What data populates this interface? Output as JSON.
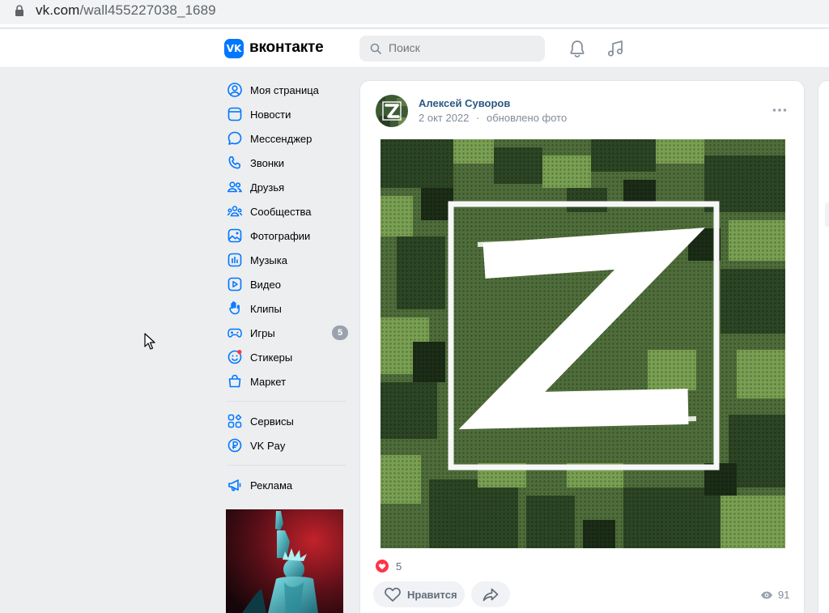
{
  "browser": {
    "url_host": "vk.com",
    "url_path": "/wall455227038_1689"
  },
  "header": {
    "logo_mark": "VK",
    "logo_text": "вконтакте",
    "search_placeholder": "Поиск",
    "icons": [
      "bell-icon",
      "music-icon"
    ]
  },
  "sidebar": {
    "items": [
      {
        "label": "Моя страница",
        "icon": "user-icon"
      },
      {
        "label": "Новости",
        "icon": "news-icon"
      },
      {
        "label": "Мессенджер",
        "icon": "messenger-icon"
      },
      {
        "label": "Звонки",
        "icon": "phone-icon"
      },
      {
        "label": "Друзья",
        "icon": "friends-icon"
      },
      {
        "label": "Сообщества",
        "icon": "communities-icon"
      },
      {
        "label": "Фотографии",
        "icon": "photos-icon"
      },
      {
        "label": "Музыка",
        "icon": "music-bars-icon"
      },
      {
        "label": "Видео",
        "icon": "video-icon"
      },
      {
        "label": "Клипы",
        "icon": "clips-icon"
      },
      {
        "label": "Игры",
        "icon": "games-icon",
        "badge": "5"
      },
      {
        "label": "Стикеры",
        "icon": "stickers-icon"
      },
      {
        "label": "Маркет",
        "icon": "market-icon"
      }
    ],
    "services": [
      {
        "label": "Сервисы",
        "icon": "services-icon"
      },
      {
        "label": "VK Pay",
        "icon": "vkpay-icon"
      }
    ],
    "ads": [
      {
        "label": "Реклама",
        "icon": "megaphone-icon"
      }
    ]
  },
  "post": {
    "author": "Алексей Суворов",
    "date": "2 окт 2022",
    "separator": "·",
    "action": "обновлено фото",
    "photo_letter": "Z",
    "reactions_count": "5",
    "like_label": "Нравится",
    "views_count": "91"
  },
  "colors": {
    "accent": "#0077ff",
    "link": "#2a5885",
    "reaction": "#ff3347"
  }
}
